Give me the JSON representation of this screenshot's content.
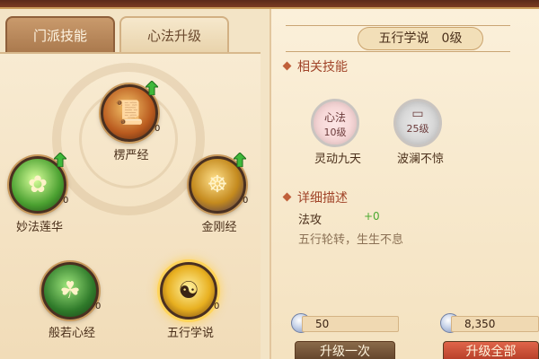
{
  "tabs": [
    {
      "label": "门派技能",
      "active": true
    },
    {
      "label": "心法升级",
      "active": false
    }
  ],
  "skills": [
    {
      "name": "楞严经",
      "level": "0",
      "icon": "scroll-icon",
      "color": "#e08a2a"
    },
    {
      "name": "金刚经",
      "level": "0",
      "icon": "golden-idol-icon",
      "color": "#d9a030"
    },
    {
      "name": "五行学说",
      "level": "0",
      "icon": "yin-yang-icon",
      "color": "#f0c440",
      "selected": true
    },
    {
      "name": "般若心经",
      "level": "0",
      "icon": "green-deity-icon",
      "color": "#3e8a3a"
    },
    {
      "name": "妙法莲华",
      "level": "0",
      "icon": "lotus-icon",
      "color": "#6fbf3a"
    }
  ],
  "detail": {
    "title": "五行学说　0级",
    "related_header": "相关技能",
    "related": [
      {
        "line1": "心法",
        "line2": "10级",
        "name": "灵动九天",
        "icon": "heart-method-badge"
      },
      {
        "line1": "",
        "line2": "25级",
        "name": "波澜不惊",
        "icon": "scroll-box-icon"
      }
    ],
    "desc_header": "详细描述",
    "stat_label": "法攻",
    "stat_value": "+0",
    "desc_text": "五行轮转，生生不息"
  },
  "costs": {
    "left_value": "50",
    "right_value": "8,350",
    "coin_icon": "silver-coin-icon"
  },
  "buttons": {
    "upgrade_once": "升级一次",
    "upgrade_all": "升级全部"
  },
  "colors": {
    "accent_red": "#a1452a",
    "stat_green": "#4caa32",
    "upgrade_all_red": "#c94a30"
  }
}
